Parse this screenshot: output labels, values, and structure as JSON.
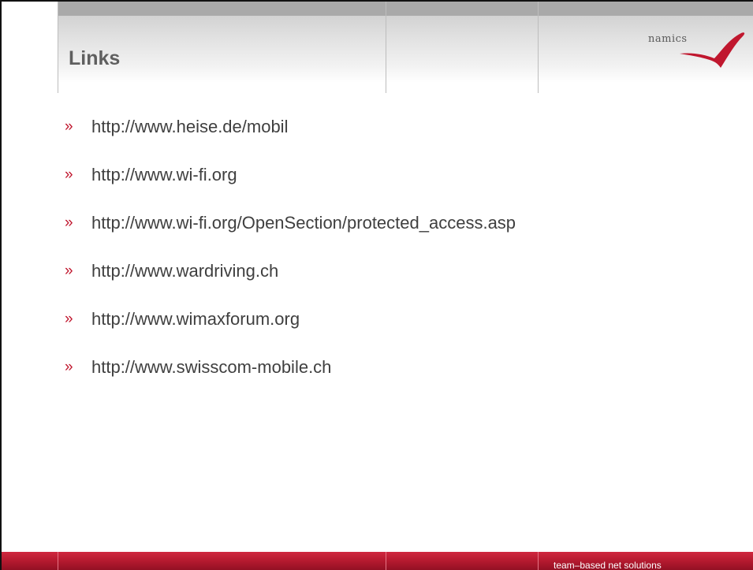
{
  "slide": {
    "title": "Links",
    "logo_text": "namics",
    "links": [
      "http://www.heise.de/mobil",
      "http://www.wi-fi.org",
      "http://www.wi-fi.org/OpenSection/protected_access.asp",
      "http://www.wardriving.ch",
      "http://www.wimaxforum.org",
      "http://www.swisscom-mobile.ch"
    ],
    "bullet": "»",
    "footer_text": "team–based net solutions"
  },
  "colors": {
    "accent": "#c0172e",
    "header_gray": "#d2d2d2",
    "text": "#3f3f3f",
    "title": "#5f5f5f"
  }
}
